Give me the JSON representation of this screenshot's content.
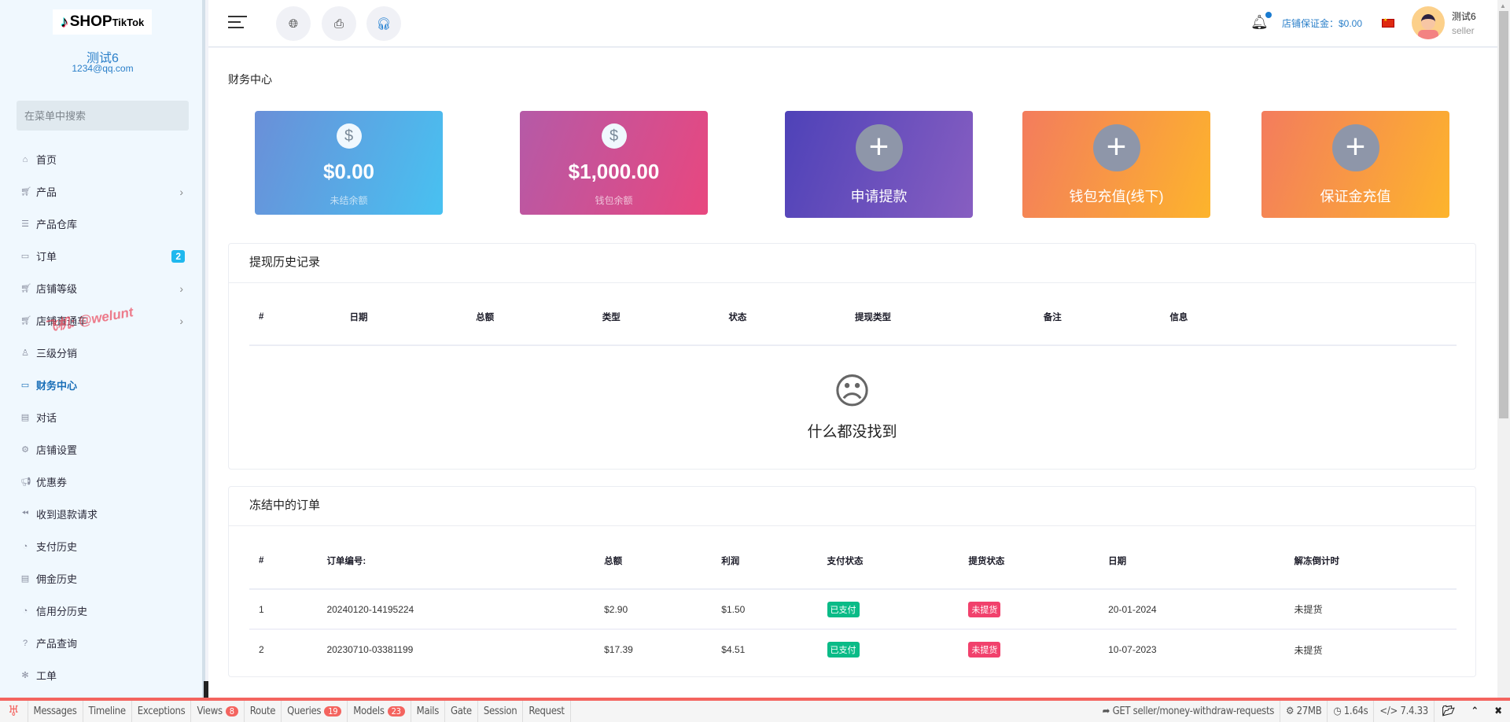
{
  "sidebar": {
    "logo": "SHOP TikTok",
    "logo_main": "SHOP",
    "logo_sub": "TikTok",
    "user_name": "测试6",
    "user_email": "1234@qq.com",
    "search_placeholder": "在菜单中搜索",
    "items": [
      {
        "label": "首页",
        "icon": "home-icon"
      },
      {
        "label": "产品",
        "icon": "cart-icon",
        "submenu": true
      },
      {
        "label": "产品仓库",
        "icon": "warehouse-icon"
      },
      {
        "label": "订单",
        "icon": "ticket-icon",
        "badge": "2"
      },
      {
        "label": "店铺等级",
        "icon": "cart-icon",
        "submenu": true
      },
      {
        "label": "店铺直通车",
        "icon": "cart-icon",
        "submenu": true
      },
      {
        "label": "三级分销",
        "icon": "user-icon"
      },
      {
        "label": "财务中心",
        "icon": "money-icon",
        "active": true
      },
      {
        "label": "对话",
        "icon": "chat-icon"
      },
      {
        "label": "店铺设置",
        "icon": "gear-icon"
      },
      {
        "label": "优惠券",
        "icon": "megaphone-icon"
      },
      {
        "label": "收到退款请求",
        "icon": "rewind-icon"
      },
      {
        "label": "支付历史",
        "icon": "history-icon"
      },
      {
        "label": "佣金历史",
        "icon": "document-icon"
      },
      {
        "label": "信用分历史",
        "icon": "history-icon"
      },
      {
        "label": "产品查询",
        "icon": "question-icon"
      },
      {
        "label": "工单",
        "icon": "settings-icon"
      }
    ],
    "watermark": "飞机: @welunt"
  },
  "header": {
    "deposit": "店铺保证金：$0.00",
    "user_name": "测试6",
    "user_role": "seller"
  },
  "page": {
    "title": "财务中心"
  },
  "cards": [
    {
      "amount": "$0.00",
      "label": "未结余额",
      "colors": [
        "#6a8fd8",
        "#48c1f1"
      ]
    },
    {
      "amount": "$1,000.00",
      "label": "钱包余额",
      "colors": [
        "#b55aa7",
        "#e8477f"
      ]
    },
    {
      "action": "申请提款",
      "colors": [
        "#4e42b8",
        "#875ec1"
      ]
    },
    {
      "action": "钱包充值(线下)",
      "colors": [
        "#f37c5d",
        "#fdb42c"
      ]
    },
    {
      "action": "保证金充值",
      "colors": [
        "#f37c5d",
        "#fdb42c"
      ]
    }
  ],
  "withdraw": {
    "title": "提现历史记录",
    "columns": [
      "#",
      "日期",
      "总额",
      "类型",
      "状态",
      "提现类型",
      "备注",
      "信息"
    ],
    "empty": "什么都没找到"
  },
  "frozen": {
    "title": "冻结中的订单",
    "columns": [
      "#",
      "订单编号:",
      "总额",
      "利润",
      "支付状态",
      "提货状态",
      "日期",
      "解冻倒计时"
    ],
    "rows": [
      [
        "1",
        "20240120-14195224",
        "$2.90",
        "$1.50",
        "已支付",
        "未提货",
        "20-01-2024",
        "未提货"
      ],
      [
        "2",
        "20230710-03381199",
        "$17.39",
        "$4.51",
        "已支付",
        "未提货",
        "10-07-2023",
        "未提货"
      ]
    ],
    "paid_color": "#0abb87",
    "unpicked_color": "#f1416c"
  },
  "debugbar": {
    "tabs": [
      {
        "label": "Messages"
      },
      {
        "label": "Timeline"
      },
      {
        "label": "Exceptions"
      },
      {
        "label": "Views",
        "count": "8"
      },
      {
        "label": "Route"
      },
      {
        "label": "Queries",
        "count": "19"
      },
      {
        "label": "Models",
        "count": "23"
      },
      {
        "label": "Mails"
      },
      {
        "label": "Gate"
      },
      {
        "label": "Session"
      },
      {
        "label": "Request"
      }
    ],
    "request": "GET seller/money-withdraw-requests",
    "memory": "27MB",
    "time": "1.64s",
    "php": "7.4.33"
  }
}
